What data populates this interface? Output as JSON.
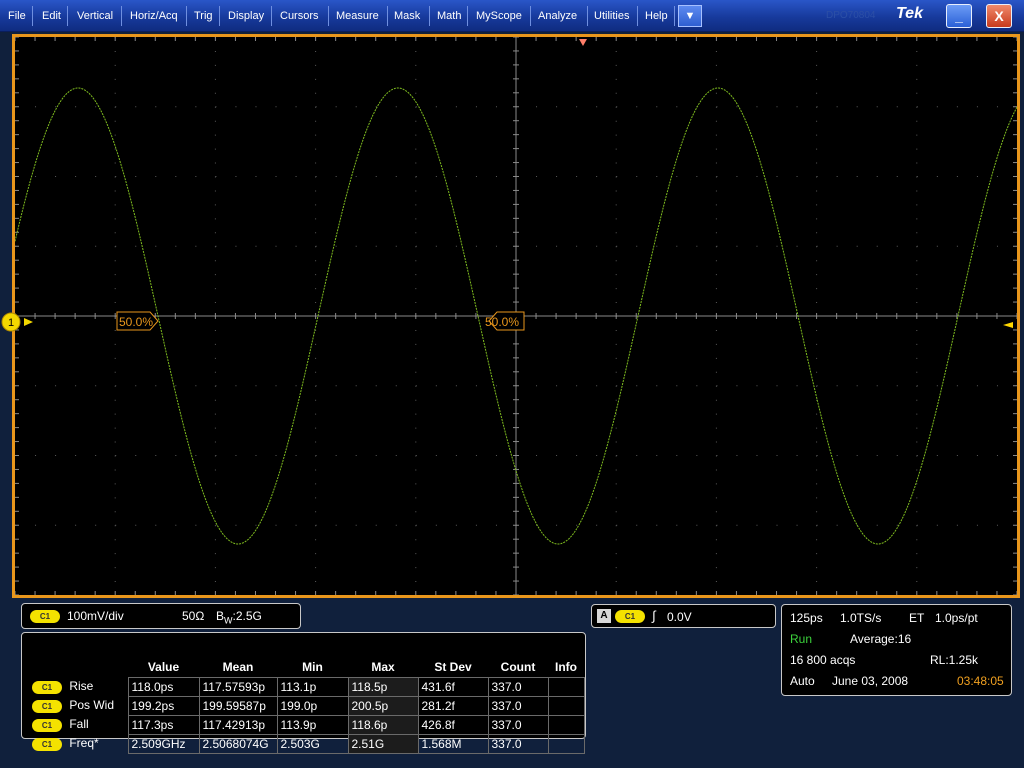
{
  "menu": {
    "items": [
      "File",
      "Edit",
      "Vertical",
      "Horiz/Acq",
      "Trig",
      "Display",
      "Cursors",
      "Measure",
      "Mask",
      "Math",
      "MyScope",
      "Analyze",
      "Utilities",
      "Help"
    ],
    "dropdown_icon": "▼",
    "watermark": "DPO70804",
    "brand": "Tek",
    "minimize_icon": "_",
    "close_icon": "X"
  },
  "display": {
    "trace_color": "#7fbd1f",
    "grid_color": "#5a5a5a",
    "channel_marker_label": "1",
    "ref_label_left": "50.0%",
    "ref_label_right": "50.0%",
    "trigger_marker_color": "#ff7f6a"
  },
  "channel": {
    "badge": "C1",
    "scale": "100mV/div",
    "impedance": "50Ω",
    "bandwidth_prefix": "B",
    "bandwidth_sub": "W",
    "bandwidth": ":2.5G"
  },
  "trigger": {
    "source_letter": "A",
    "badge": "C1",
    "slope_icon": "∫",
    "level": "0.0V"
  },
  "measurements": {
    "headers": [
      "",
      "Value",
      "Mean",
      "Min",
      "Max",
      "St Dev",
      "Count",
      "Info"
    ],
    "rows": [
      {
        "badge": "C1",
        "label": "Rise",
        "value": "118.0ps",
        "mean": "117.57593p",
        "min": "113.1p",
        "max": "118.5p",
        "stdev": "431.6f",
        "count": "337.0",
        "info": ""
      },
      {
        "badge": "C1",
        "label": "Pos Wid",
        "value": "199.2ps",
        "mean": "199.59587p",
        "min": "199.0p",
        "max": "200.5p",
        "stdev": "281.2f",
        "count": "337.0",
        "info": ""
      },
      {
        "badge": "C1",
        "label": "Fall",
        "value": "117.3ps",
        "mean": "117.42913p",
        "min": "113.9p",
        "max": "118.6p",
        "stdev": "426.8f",
        "count": "337.0",
        "info": ""
      },
      {
        "badge": "C1",
        "label": "Freq*",
        "value": "2.509GHz",
        "mean": "2.5068074G",
        "min": "2.503G",
        "max": "2.51G",
        "stdev": "1.568M",
        "count": "337.0",
        "info": ""
      }
    ]
  },
  "acquisition": {
    "timebase": "125ps",
    "sample_rate": "1.0TS/s",
    "mode": "ET",
    "resolution": "1.0ps/pt",
    "state": "Run",
    "average": "Average:16",
    "acqs": "16 800 acqs",
    "record_length": "RL:1.25k",
    "trigger_mode": "Auto",
    "date": "June 03, 2008",
    "time": "03:48:05",
    "state_color": "#3cd23c",
    "time_color": "#f0a020"
  }
}
